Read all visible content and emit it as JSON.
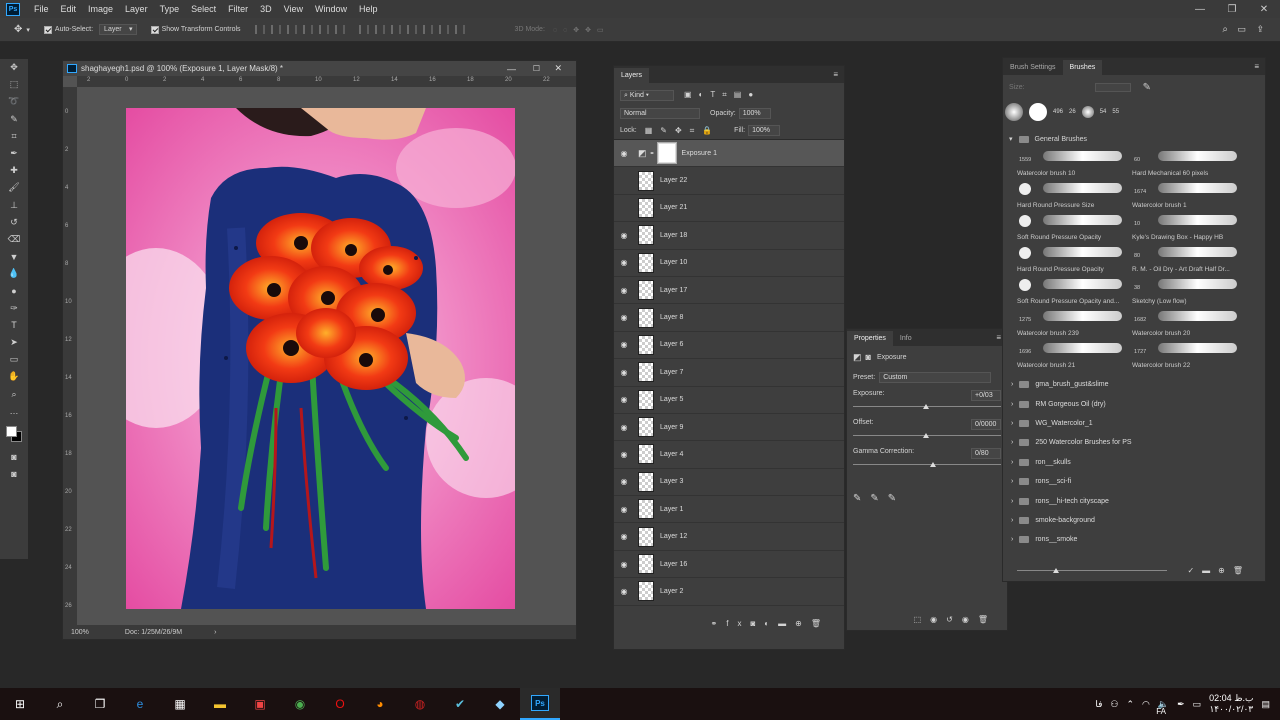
{
  "menubar": {
    "logo": "Ps",
    "items": [
      "File",
      "Edit",
      "Image",
      "Layer",
      "Type",
      "Select",
      "Filter",
      "3D",
      "View",
      "Window",
      "Help"
    ]
  },
  "options": {
    "auto_select": "Auto-Select:",
    "auto_select_target": "Layer",
    "show_transform": "Show Transform Controls",
    "mode_3d": "3D Mode:"
  },
  "document": {
    "title": "shaghayegh1.psd @ 100% (Exposure 1, Layer Mask/8) *",
    "zoom": "100%",
    "doc_info": "Doc: 1/25M/26/9M",
    "ruler_h": [
      "2",
      "0",
      "2",
      "4",
      "6",
      "8",
      "10",
      "12",
      "14",
      "16",
      "18",
      "20",
      "22"
    ],
    "ruler_v": [
      "0",
      "2",
      "4",
      "6",
      "8",
      "10",
      "12",
      "14",
      "16",
      "18",
      "20",
      "22",
      "24",
      "26"
    ]
  },
  "layers_panel": {
    "tab": "Layers",
    "kind": "Kind",
    "blend": "Normal",
    "opacity_label": "Opacity:",
    "opacity": "100%",
    "lock_label": "Lock:",
    "fill_label": "Fill:",
    "fill": "100%",
    "layers": [
      {
        "name": "Exposure 1",
        "visible": true,
        "selected": true
      },
      {
        "name": "Layer 22",
        "visible": false
      },
      {
        "name": "Layer 21",
        "visible": false
      },
      {
        "name": "Layer 18",
        "visible": true
      },
      {
        "name": "Layer 10",
        "visible": true
      },
      {
        "name": "Layer 17",
        "visible": true
      },
      {
        "name": "Layer 8",
        "visible": true
      },
      {
        "name": "Layer 6",
        "visible": true
      },
      {
        "name": "Layer 7",
        "visible": true
      },
      {
        "name": "Layer 5",
        "visible": true
      },
      {
        "name": "Layer 9",
        "visible": true
      },
      {
        "name": "Layer 4",
        "visible": true
      },
      {
        "name": "Layer 3",
        "visible": true
      },
      {
        "name": "Layer 1",
        "visible": true
      },
      {
        "name": "Layer 12",
        "visible": true
      },
      {
        "name": "Layer 16",
        "visible": true
      },
      {
        "name": "Layer 2",
        "visible": true
      }
    ]
  },
  "properties": {
    "tabs": [
      "Properties",
      "Info"
    ],
    "adjustment": "Exposure",
    "preset_label": "Preset:",
    "preset": "Custom",
    "exposure_label": "Exposure:",
    "exposure": "+0/03",
    "exposure_pos": 0.5,
    "offset_label": "Offset:",
    "offset": "0/0000",
    "offset_pos": 0.5,
    "gamma_label": "Gamma Correction:",
    "gamma": "0/80",
    "gamma_pos": 0.55
  },
  "brushes_panel": {
    "tabs": [
      "Brush Settings",
      "Brushes"
    ],
    "size_label": "Size:",
    "preset_nums": [
      "496",
      "26",
      "54",
      "55"
    ],
    "group": "General Brushes",
    "brushes": [
      {
        "name": "Watercolor brush 10",
        "num": "1559"
      },
      {
        "name": "Hard Mechanical 60 pixels",
        "num": "60"
      },
      {
        "name": "Hard Round Pressure Size",
        "num": ""
      },
      {
        "name": "Watercolor brush 1",
        "num": "1674"
      },
      {
        "name": "Soft Round Pressure Opacity",
        "num": ""
      },
      {
        "name": "Kyle's Drawing Box - Happy HB",
        "num": "10"
      },
      {
        "name": "Hard Round Pressure Opacity",
        "num": ""
      },
      {
        "name": "R. M. - Oil Dry - Art Draft Half Dr...",
        "num": "80"
      },
      {
        "name": "Soft Round Pressure Opacity and...",
        "num": ""
      },
      {
        "name": "Sketchy (Low flow)",
        "num": "38"
      },
      {
        "name": "Watercolor brush 239",
        "num": "1275"
      },
      {
        "name": "Watercolor brush 20",
        "num": "1682"
      },
      {
        "name": "Watercolor brush 21",
        "num": "1696"
      },
      {
        "name": "Watercolor brush 22",
        "num": "1727"
      }
    ],
    "folders": [
      "gma_brush_gust&slime",
      "RM Gorgeous Oil (dry)",
      "WG_Watercolor_1",
      "250 Watercolor Brushes for PS",
      "ron__skulls",
      "rons__sci-fi",
      "rons__hi-tech cityscape",
      "smoke-background",
      "rons__smoke"
    ]
  },
  "taskbar": {
    "time": "02:04 ب.ظ",
    "date": "۱۴۰۰/۰۲/۰۳",
    "lang": "FA",
    "lang2": "فا"
  },
  "colors": {
    "ps_blue": "#31a8ff",
    "panel": "#3e3e3e",
    "canvas_pink": "#ec5fa8",
    "dress": "#1b2f7a",
    "flower": "#f03a12"
  }
}
